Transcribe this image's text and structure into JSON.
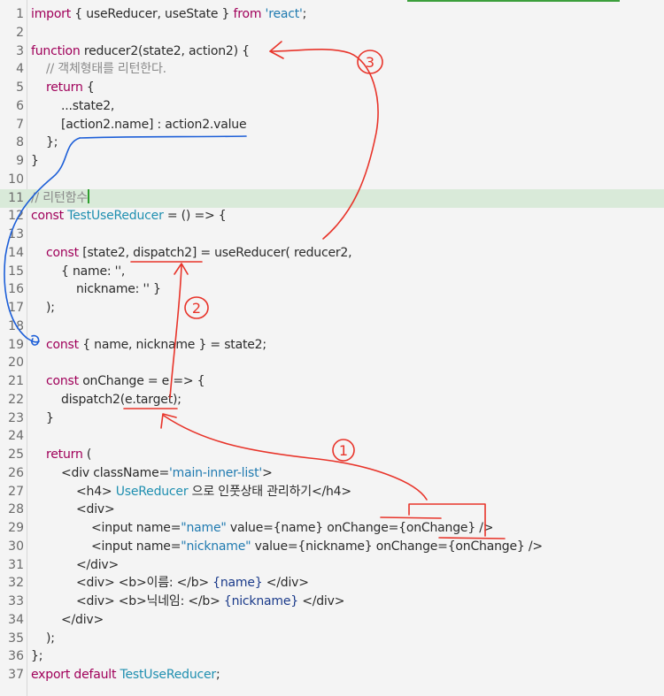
{
  "lines": [
    {
      "n": "1",
      "p": [
        [
          "import ",
          "k"
        ],
        [
          "{ useReducer, useState } ",
          ""
        ],
        [
          "from ",
          "k"
        ],
        [
          "'react'",
          "s"
        ],
        [
          ";",
          ""
        ]
      ]
    },
    {
      "n": "2",
      "p": []
    },
    {
      "n": "3",
      "p": [
        [
          "function ",
          "k"
        ],
        [
          "reducer2(state2, action2) {",
          ""
        ]
      ]
    },
    {
      "n": "4",
      "p": [
        [
          "    // 객체형태를 리턴한다.",
          "c"
        ]
      ]
    },
    {
      "n": "5",
      "p": [
        [
          "    ",
          ""
        ],
        [
          "return ",
          "k"
        ],
        [
          "{",
          ""
        ]
      ]
    },
    {
      "n": "6",
      "p": [
        [
          "        ...state2,",
          ""
        ]
      ]
    },
    {
      "n": "7",
      "p": [
        [
          "        [action2.name] : action2.value",
          ""
        ]
      ]
    },
    {
      "n": "8",
      "p": [
        [
          "    };",
          ""
        ]
      ]
    },
    {
      "n": "9",
      "p": [
        [
          "}",
          ""
        ]
      ]
    },
    {
      "n": "10",
      "p": []
    },
    {
      "n": "11",
      "p": [
        [
          "// 리턴함수",
          "c"
        ]
      ],
      "cursor": true
    },
    {
      "n": "12",
      "p": [
        [
          "const ",
          "k"
        ],
        [
          "TestUseReducer",
          "t"
        ],
        [
          " = () => {",
          ""
        ]
      ]
    },
    {
      "n": "13",
      "p": []
    },
    {
      "n": "14",
      "p": [
        [
          "    ",
          ""
        ],
        [
          "const ",
          "k"
        ],
        [
          "[state2, dispatch2] = useReducer( reducer2,",
          ""
        ]
      ]
    },
    {
      "n": "15",
      "p": [
        [
          "        { name: '',",
          ""
        ]
      ]
    },
    {
      "n": "16",
      "p": [
        [
          "            nickname: '' }",
          ""
        ]
      ]
    },
    {
      "n": "17",
      "p": [
        [
          "    );",
          ""
        ]
      ]
    },
    {
      "n": "18",
      "p": []
    },
    {
      "n": "19",
      "p": [
        [
          "    ",
          ""
        ],
        [
          "const ",
          "k"
        ],
        [
          "{ name, nickname } = state2;",
          ""
        ]
      ]
    },
    {
      "n": "20",
      "p": []
    },
    {
      "n": "21",
      "p": [
        [
          "    ",
          ""
        ],
        [
          "const ",
          "k"
        ],
        [
          "onChange = e => {",
          ""
        ]
      ]
    },
    {
      "n": "22",
      "p": [
        [
          "        dispatch2(e.target);",
          ""
        ]
      ]
    },
    {
      "n": "23",
      "p": [
        [
          "    }",
          ""
        ]
      ]
    },
    {
      "n": "24",
      "p": []
    },
    {
      "n": "25",
      "p": [
        [
          "    ",
          ""
        ],
        [
          "return ",
          "k"
        ],
        [
          "(",
          ""
        ]
      ]
    },
    {
      "n": "26",
      "p": [
        [
          "        <div className=",
          ""
        ],
        [
          "'main-inner-list'",
          "s"
        ],
        [
          ">",
          ""
        ]
      ]
    },
    {
      "n": "27",
      "p": [
        [
          "            <h4> ",
          ""
        ],
        [
          "UseReducer",
          "t"
        ],
        [
          " 으로 인풋상태 관리하기</h4>",
          ""
        ]
      ]
    },
    {
      "n": "28",
      "p": [
        [
          "            <div>",
          ""
        ]
      ]
    },
    {
      "n": "29",
      "p": [
        [
          "                <input name=",
          ""
        ],
        [
          "\"name\"",
          "s"
        ],
        [
          " value={name} onChange={onChange} />",
          ""
        ]
      ]
    },
    {
      "n": "30",
      "p": [
        [
          "                <input name=",
          ""
        ],
        [
          "\"nickname\"",
          "s"
        ],
        [
          " value={nickname} onChange={onChange} />",
          ""
        ]
      ]
    },
    {
      "n": "31",
      "p": [
        [
          "            </div>",
          ""
        ]
      ]
    },
    {
      "n": "32",
      "p": [
        [
          "            <div> <b>이름: </b> ",
          ""
        ],
        [
          "{name}",
          "v"
        ],
        [
          " </div>",
          ""
        ]
      ]
    },
    {
      "n": "33",
      "p": [
        [
          "            <div> <b>닉네임: </b> ",
          ""
        ],
        [
          "{nickname}",
          "v"
        ],
        [
          " </div>",
          ""
        ]
      ]
    },
    {
      "n": "34",
      "p": [
        [
          "        </div>",
          ""
        ]
      ]
    },
    {
      "n": "35",
      "p": [
        [
          "    );",
          ""
        ]
      ]
    },
    {
      "n": "36",
      "p": [
        [
          "};",
          ""
        ]
      ]
    },
    {
      "n": "37",
      "p": [
        [
          "export default ",
          "k"
        ],
        [
          "TestUseReducer",
          "t"
        ],
        [
          ";",
          ""
        ]
      ]
    }
  ],
  "annotations": {
    "label_1": "1",
    "label_2": "2",
    "label_3": "3"
  },
  "colors": {
    "annotation_red": "#e8342a",
    "annotation_blue": "#1d5fd8",
    "line_highlight": "#d9ead9"
  }
}
